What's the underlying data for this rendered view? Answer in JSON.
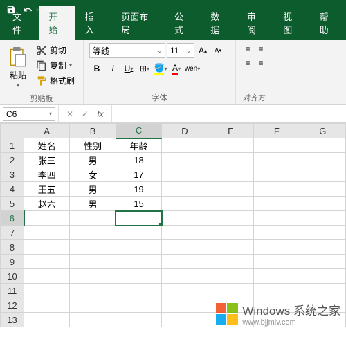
{
  "qat": {
    "save": "保存",
    "undo": "撤销",
    "redo": "重做"
  },
  "tabs": {
    "file": "文件",
    "home": "开始",
    "insert": "插入",
    "layout": "页面布局",
    "formula": "公式",
    "data": "数据",
    "review": "审阅",
    "view": "视图",
    "help": "帮助"
  },
  "ribbon": {
    "clipboard": {
      "paste": "粘贴",
      "cut": "剪切",
      "copy": "复制",
      "format_painter": "格式刷",
      "label": "剪贴板"
    },
    "font": {
      "name": "等线",
      "size": "11",
      "label": "字体",
      "b": "B",
      "i": "I",
      "u": "U",
      "wen": "wén"
    },
    "align": {
      "label": "对齐方"
    }
  },
  "namebox": "C6",
  "formula": "",
  "fb": {
    "cancel": "✕",
    "enter": "✓",
    "fx": "fx"
  },
  "columns": [
    "A",
    "B",
    "C",
    "D",
    "E",
    "F",
    "G"
  ],
  "rows": [
    "1",
    "2",
    "3",
    "4",
    "5",
    "6",
    "7",
    "8",
    "9",
    "10",
    "11",
    "12",
    "13"
  ],
  "cells": {
    "A1": "姓名",
    "B1": "性别",
    "C1": "年龄",
    "A2": "张三",
    "B2": "男",
    "C2": "18",
    "A3": "李四",
    "B3": "女",
    "C3": "17",
    "A4": "王五",
    "B4": "男",
    "C4": "19",
    "A5": "赵六",
    "B5": "男",
    "C5": "15"
  },
  "active": "C6",
  "watermark": {
    "title": "Windows 系统之家",
    "url": "www.bjjmlv.com"
  }
}
